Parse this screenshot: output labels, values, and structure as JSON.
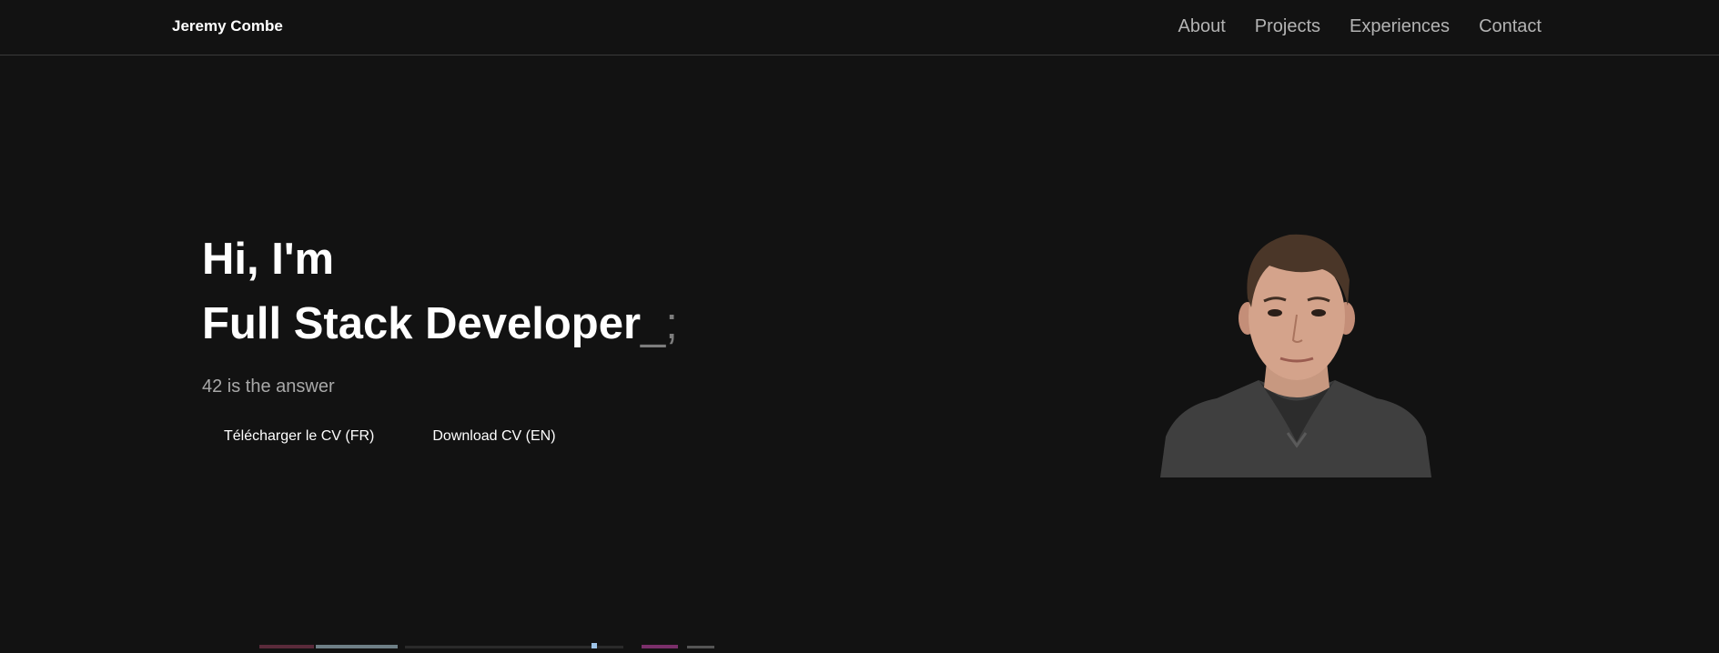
{
  "header": {
    "brand": "Jeremy Combe",
    "nav": [
      "About",
      "Projects",
      "Experiences",
      "Contact"
    ]
  },
  "hero": {
    "greeting": "Hi, I'm",
    "role": "Full Stack Developer",
    "cursor": "_;",
    "tagline": "42 is the answer",
    "buttons": {
      "cv_fr": "Télécharger le CV (FR)",
      "cv_en": "Download CV (EN)"
    }
  },
  "colors": {
    "background": "#121212",
    "text": "#ffffff",
    "muted": "#b3b3b3",
    "border": "#3a3a3a"
  },
  "icons": {
    "portrait": "profile-photo"
  }
}
